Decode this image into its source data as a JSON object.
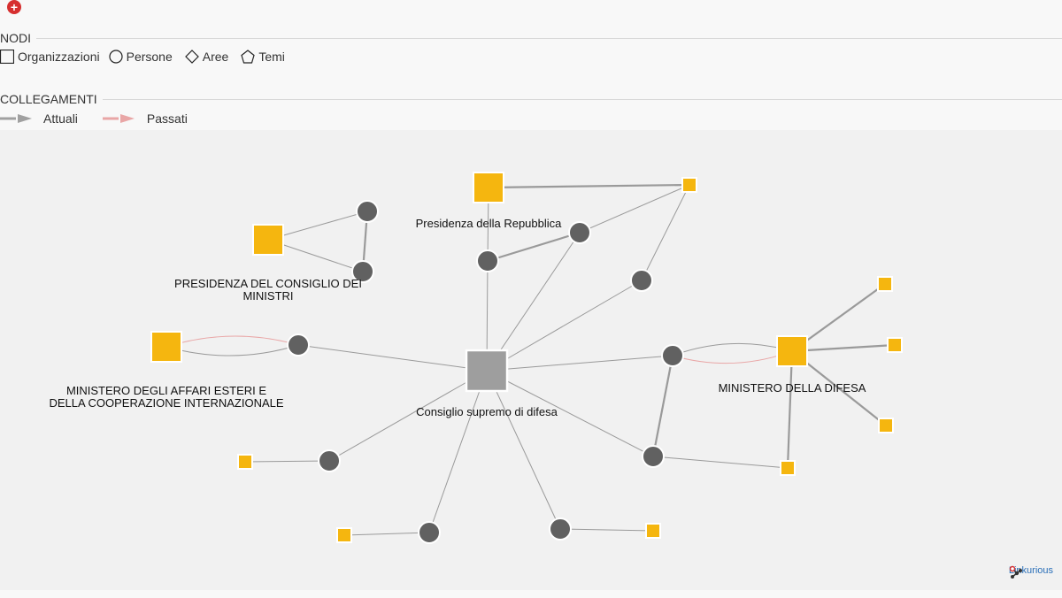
{
  "toolbar": {
    "expand_symbol": "+",
    "nodes_section": {
      "title": "NODI",
      "items": [
        {
          "shape": "square",
          "label": "Organizzazioni"
        },
        {
          "shape": "circle",
          "label": "Persone"
        },
        {
          "shape": "diamond",
          "label": "Aree"
        },
        {
          "shape": "pentagon",
          "label": "Temi"
        }
      ]
    },
    "links_section": {
      "title": "COLLEGAMENTI",
      "items": [
        {
          "style": "current",
          "label": "Attuali",
          "color": "#a0a0a0"
        },
        {
          "style": "past",
          "label": "Passati",
          "color": "#e9a6a6"
        }
      ]
    }
  },
  "graph": {
    "colors": {
      "org": "#f5b60f",
      "person": "#616161",
      "center": "#9e9e9e",
      "current_edge": "#9a9a9a",
      "past_edge": "#e9a6a6"
    },
    "nodes": [
      {
        "id": "center",
        "type": "center",
        "label": "Consiglio supremo di difesa"
      },
      {
        "id": "presidenza-repubblica",
        "type": "org",
        "label": "Presidenza della Repubblica"
      },
      {
        "id": "presidenza-consiglio",
        "type": "org",
        "label": "PRESIDENZA DEL CONSIGLIO DEI MINISTRI"
      },
      {
        "id": "ministero-esteri",
        "type": "org",
        "label": "MINISTERO DEGLI AFFARI ESTERI E DELLA COOPERAZIONE INTERNAZIONALE"
      },
      {
        "id": "ministero-difesa",
        "type": "org",
        "label": "MINISTERO DELLA DIFESA"
      },
      {
        "id": "org-a",
        "type": "org-small",
        "label": ""
      },
      {
        "id": "org-b",
        "type": "org-small",
        "label": ""
      },
      {
        "id": "org-c",
        "type": "org-small",
        "label": ""
      },
      {
        "id": "org-d",
        "type": "org-small",
        "label": ""
      },
      {
        "id": "org-e",
        "type": "org-small",
        "label": ""
      },
      {
        "id": "org-f",
        "type": "org-small",
        "label": ""
      },
      {
        "id": "org-g",
        "type": "org-small",
        "label": ""
      },
      {
        "id": "org-h",
        "type": "org-small",
        "label": ""
      },
      {
        "id": "org-i",
        "type": "org-small",
        "label": ""
      },
      {
        "id": "person-1",
        "type": "person",
        "label": ""
      },
      {
        "id": "person-2",
        "type": "person",
        "label": ""
      },
      {
        "id": "person-3",
        "type": "person",
        "label": ""
      },
      {
        "id": "person-4",
        "type": "person",
        "label": ""
      },
      {
        "id": "person-5",
        "type": "person",
        "label": ""
      },
      {
        "id": "person-6",
        "type": "person",
        "label": ""
      },
      {
        "id": "person-7",
        "type": "person",
        "label": ""
      },
      {
        "id": "person-8",
        "type": "person",
        "label": ""
      },
      {
        "id": "person-9",
        "type": "person",
        "label": ""
      },
      {
        "id": "person-10",
        "type": "person",
        "label": ""
      },
      {
        "id": "person-11",
        "type": "person",
        "label": ""
      }
    ],
    "edges": [
      {
        "from": "center",
        "to": "person-5",
        "kind": "current"
      },
      {
        "from": "center",
        "to": "person-3",
        "kind": "current"
      },
      {
        "from": "center",
        "to": "person-4",
        "kind": "current"
      },
      {
        "from": "center",
        "to": "person-6",
        "kind": "current"
      },
      {
        "from": "center",
        "to": "person-7",
        "kind": "current"
      },
      {
        "from": "center",
        "to": "person-8",
        "kind": "current"
      },
      {
        "from": "center",
        "to": "person-9",
        "kind": "current"
      },
      {
        "from": "center",
        "to": "person-10",
        "kind": "current"
      },
      {
        "from": "center",
        "to": "person-11",
        "kind": "current"
      },
      {
        "from": "presidenza-consiglio",
        "to": "person-1",
        "kind": "current"
      },
      {
        "from": "presidenza-consiglio",
        "to": "person-2",
        "kind": "current"
      },
      {
        "from": "person-1",
        "to": "person-2",
        "kind": "current"
      },
      {
        "from": "presidenza-repubblica",
        "to": "org-a",
        "kind": "current"
      },
      {
        "from": "presidenza-repubblica",
        "to": "person-4",
        "kind": "current"
      },
      {
        "from": "person-4",
        "to": "person-3",
        "kind": "current"
      },
      {
        "from": "person-3",
        "to": "org-a",
        "kind": "current"
      },
      {
        "from": "person-6",
        "to": "org-a",
        "kind": "current"
      },
      {
        "from": "ministero-esteri",
        "to": "person-5",
        "kind": "current",
        "curve": 1
      },
      {
        "from": "ministero-esteri",
        "to": "person-5",
        "kind": "past",
        "curve": -1
      },
      {
        "from": "person-7",
        "to": "ministero-difesa",
        "kind": "current",
        "curve": -1
      },
      {
        "from": "person-7",
        "to": "ministero-difesa",
        "kind": "past",
        "curve": 1
      },
      {
        "from": "ministero-difesa",
        "to": "org-b",
        "kind": "current"
      },
      {
        "from": "ministero-difesa",
        "to": "org-c",
        "kind": "current"
      },
      {
        "from": "ministero-difesa",
        "to": "org-d",
        "kind": "current"
      },
      {
        "from": "ministero-difesa",
        "to": "org-e",
        "kind": "current"
      },
      {
        "from": "person-7",
        "to": "person-8",
        "kind": "current"
      },
      {
        "from": "person-8",
        "to": "org-e",
        "kind": "current"
      },
      {
        "from": "person-9",
        "to": "org-f",
        "kind": "current"
      },
      {
        "from": "person-10",
        "to": "org-g",
        "kind": "current"
      },
      {
        "from": "person-11",
        "to": "org-h",
        "kind": "current"
      }
    ]
  },
  "brand": {
    "name": "Linkurious"
  }
}
